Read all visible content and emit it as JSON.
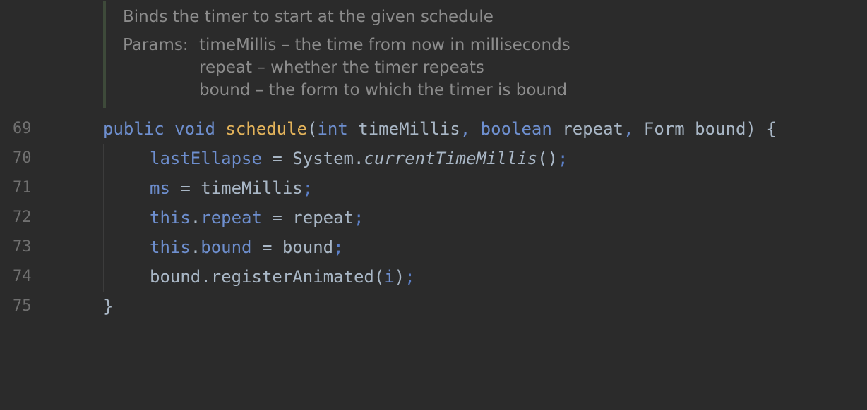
{
  "javadoc": {
    "summary": "Binds the timer to start at the given schedule",
    "params_label": "Params:",
    "params": [
      "timeMillis – the time from now in milliseconds",
      "repeat – whether the timer repeats",
      "bound – the form to which the timer is bound"
    ]
  },
  "code": {
    "line_numbers": [
      "69",
      "70",
      "71",
      "72",
      "73",
      "74",
      "75"
    ],
    "l69": {
      "kw1": "public",
      "kw2": "void",
      "method": "schedule",
      "paren_open": "(",
      "type1": "int",
      "arg1": "timeMillis",
      "comma1": ",",
      "type2": "boolean",
      "arg2": "repeat",
      "comma2": ",",
      "type3": "Form",
      "arg3": "bound",
      "end": ") {"
    },
    "l70": {
      "field": "lastEllapse",
      "eq": " = System.",
      "call": "currentTimeMillis",
      "parens": "()",
      "semi": ";"
    },
    "l71": {
      "field": "ms",
      "rest": " = timeMillis",
      "semi": ";"
    },
    "l72": {
      "this": "this",
      "dot": ".",
      "field": "repeat",
      "rest": " = repeat",
      "semi": ";"
    },
    "l73": {
      "this": "this",
      "dot": ".",
      "field": "bound",
      "rest": " = bound",
      "semi": ";"
    },
    "l74": {
      "text": "bound.registerAnimated(",
      "arg": "i",
      "close": ")",
      "semi": ";"
    },
    "l75": {
      "text": "}"
    }
  }
}
